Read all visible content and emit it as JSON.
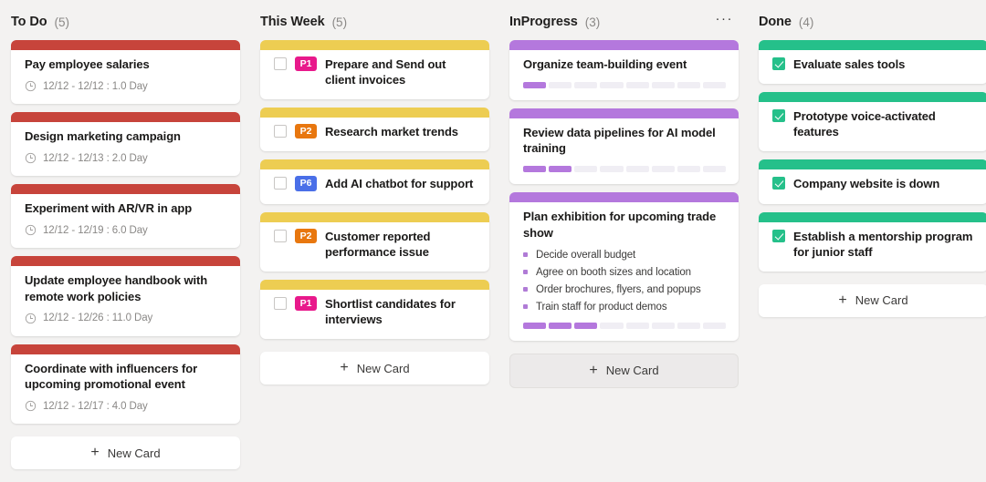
{
  "board": {
    "background": "#f3f2f1",
    "new_card_label": "New Card",
    "menu_glyph": "···"
  },
  "columns": [
    {
      "id": "todo",
      "title": "To Do",
      "count": "(5)",
      "accent": "#c7443b",
      "has_menu": false,
      "card_style": "date",
      "new_card_style": "white",
      "cards": [
        {
          "title": "Pay employee salaries",
          "date": "12/12 - 12/12 : 1.0 Day"
        },
        {
          "title": "Design marketing campaign",
          "date": "12/12 - 12/13 : 2.0 Day"
        },
        {
          "title": "Experiment with AR/VR in app",
          "date": "12/12 - 12/19 : 6.0 Day"
        },
        {
          "title": "Update employee handbook with remote work policies",
          "date": "12/12 - 12/26 : 11.0 Day"
        },
        {
          "title": "Coordinate with influencers for upcoming promotional event",
          "date": "12/12 - 12/17 : 4.0 Day"
        }
      ]
    },
    {
      "id": "thisweek",
      "title": "This Week",
      "count": "(5)",
      "accent": "#edcd52",
      "has_menu": false,
      "card_style": "checkbox",
      "new_card_style": "white",
      "cards": [
        {
          "title": "Prepare and Send out client invoices",
          "priority": "P1",
          "priority_color": "#e8198b",
          "checked": false
        },
        {
          "title": "Research market trends",
          "priority": "P2",
          "priority_color": "#e8770f",
          "checked": false
        },
        {
          "title": "Add AI chatbot for support",
          "priority": "P6",
          "priority_color": "#4a6fe8",
          "checked": false
        },
        {
          "title": "Customer reported performance issue",
          "priority": "P2",
          "priority_color": "#e8770f",
          "checked": false
        },
        {
          "title": "Shortlist candidates for interviews",
          "priority": "P1",
          "priority_color": "#e8198b",
          "checked": false
        }
      ]
    },
    {
      "id": "inprogress",
      "title": "InProgress",
      "count": "(3)",
      "accent": "#b478dd",
      "has_menu": true,
      "card_style": "progress",
      "new_card_style": "muted",
      "cards": [
        {
          "title": "Organize team-building event",
          "progress_total": 8,
          "progress_filled": 1,
          "subtasks": []
        },
        {
          "title": "Review data pipelines for AI model training",
          "progress_total": 8,
          "progress_filled": 2,
          "subtasks": []
        },
        {
          "title": "Plan exhibition for upcoming trade show",
          "progress_total": 8,
          "progress_filled": 3,
          "subtasks": [
            "Decide overall budget",
            "Agree on booth sizes and location",
            "Order brochures, flyers, and popups",
            "Train staff for product demos"
          ]
        }
      ]
    },
    {
      "id": "done",
      "title": "Done",
      "count": "(4)",
      "accent": "#25c08a",
      "has_menu": false,
      "card_style": "checkbox",
      "new_card_style": "white",
      "cards": [
        {
          "title": "Evaluate sales tools",
          "checked": true
        },
        {
          "title": "Prototype voice-activated features",
          "checked": true
        },
        {
          "title": "Company website is down",
          "checked": true
        },
        {
          "title": "Establish a mentorship program for junior staff",
          "checked": true
        }
      ]
    }
  ]
}
